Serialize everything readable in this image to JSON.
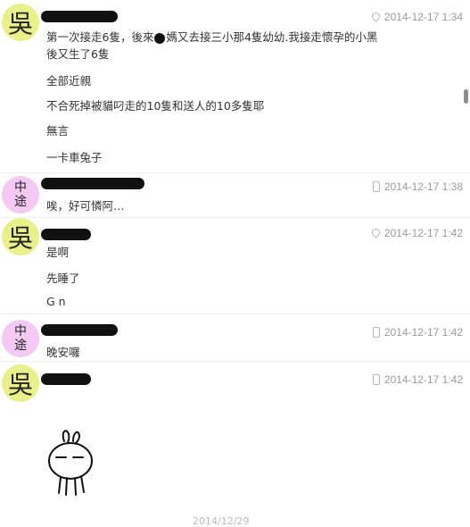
{
  "messages": [
    {
      "avatar": "吳",
      "timestamp": "2014-12-17 1:34",
      "meta_icon": "pin-icon",
      "lines": [
        "第一次接走6隻，後來",
        "媽又去接三小那4隻幼幼.我接走懷孕的小黑",
        "後又生了6隻",
        "全部近親",
        "不合死掉被貓叼走的10隻和送人的10多隻耶",
        "無言",
        "一卡車兔子"
      ]
    },
    {
      "avatar": "中途",
      "timestamp": "2014-12-17 1:38",
      "meta_icon": "phone-icon",
      "lines": [
        "唉，好可憐阿…"
      ]
    },
    {
      "avatar": "吳",
      "timestamp": "2014-12-17 1:42",
      "meta_icon": "pin-icon",
      "lines": [
        "是啊",
        "先睡了",
        "G n"
      ]
    },
    {
      "avatar": "中途",
      "timestamp": "2014-12-17 1:42",
      "meta_icon": "phone-icon",
      "lines": [
        "晚安囉"
      ]
    },
    {
      "avatar": "吳",
      "timestamp": "2014-12-17 1:42",
      "meta_icon": "phone-icon",
      "lines": []
    }
  ],
  "footer": {
    "date_partial": "2014/12/29"
  }
}
